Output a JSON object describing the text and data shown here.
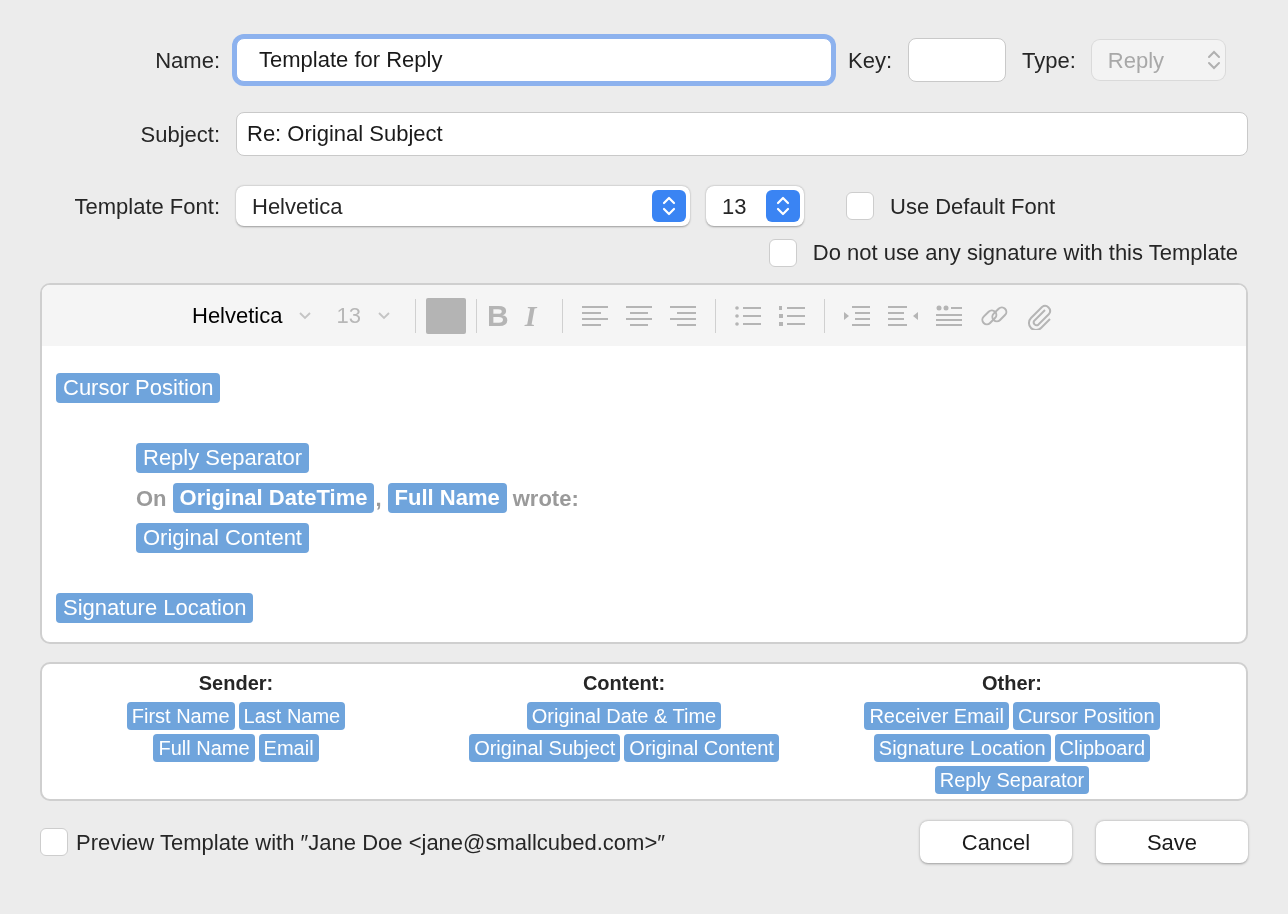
{
  "name_field": {
    "label": "Name:",
    "value": "Template for Reply",
    "focused": true
  },
  "key_field": {
    "label": "Key:"
  },
  "type_popup": {
    "label": "Type:",
    "value": "Reply",
    "disabled": true
  },
  "subject_field": {
    "label": "Subject:",
    "value": "Re: Original Subject"
  },
  "font_row": {
    "label": "Template Font:",
    "font": "Helvetica",
    "size": "13"
  },
  "checkboxes": [
    {
      "label": "Use Default Font",
      "checked": false
    },
    {
      "label": "Do not use any signature with this Template",
      "checked": false
    }
  ],
  "toolbar": {
    "font": "Helvetica",
    "size": "13",
    "size_disabled": true,
    "style_buttons": [
      "B",
      "I"
    ]
  },
  "paragraphs": [
    {
      "lines": [
        [
          {
            "kind": "token",
            "text": "Cursor Position",
            "bold": false
          }
        ]
      ]
    },
    {
      "children": [
        {
          "lines": [
            [
              {
                "kind": "token",
                "text": "Reply Separator",
                "bold": false
              }
            ],
            [
              {
                "kind": "text",
                "text": "On"
              },
              {
                "kind": "token",
                "text": "Original DateTime",
                "bold": true
              },
              {
                "kind": "text",
                "text": ","
              },
              {
                "kind": "token",
                "text": "Full Name",
                "bold": true
              },
              {
                "kind": "text",
                "text": "wrote:"
              }
            ],
            [
              {
                "kind": "token",
                "text": "Original Content",
                "bold": false
              }
            ]
          ]
        }
      ]
    },
    {
      "lines": [
        [
          {
            "kind": "token",
            "text": "Signature Location",
            "bold": false
          }
        ]
      ]
    }
  ],
  "variable_groups": [
    {
      "heading": "Sender:",
      "rows": [
        [
          "First Name",
          "Last Name"
        ],
        [
          "Full Name",
          "Email"
        ]
      ]
    },
    {
      "heading": "Content:",
      "rows": [
        [
          "Original Date & Time"
        ],
        [
          "Original Subject",
          "Original Content"
        ]
      ]
    },
    {
      "heading": "Other:",
      "rows": [
        [
          "Receiver Email",
          "Cursor Position"
        ],
        [
          "Signature Location",
          "Clipboard"
        ],
        [
          "Reply Separator"
        ]
      ]
    }
  ],
  "preview": {
    "label": "Preview Template with ″Jane Doe <jane@smallcubed.com>″",
    "checked": false
  },
  "buttons": [
    "Cancel",
    "Save"
  ]
}
